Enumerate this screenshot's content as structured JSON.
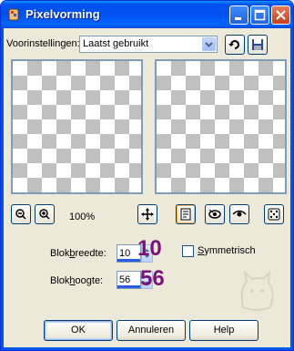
{
  "window": {
    "title": "Pixelvorming",
    "icons": {
      "app": "pixel-app-icon",
      "minimize": "minimize-icon",
      "maximize": "maximize-icon",
      "close": "close-icon"
    }
  },
  "presets": {
    "label": "Voorinstellingen:",
    "selected": "Laatst gebruikt",
    "icons": {
      "reset": "reset-icon",
      "save": "save-disk-icon"
    }
  },
  "preview_toolbar": {
    "zoom_level": "100%",
    "icons": [
      "zoom-out-icon",
      "zoom-in-icon",
      "move-icon",
      "proof-icon",
      "auto-proof-icon",
      "preview-eye-icon",
      "randomize-dice-icon"
    ]
  },
  "block_width": {
    "label_pre": "Blok",
    "label_u": "b",
    "label_post": "reedte:",
    "value": "10",
    "overlay": "10"
  },
  "block_height": {
    "label_pre": "Blok",
    "label_u": "h",
    "label_post": "oogte:",
    "value": "56",
    "overlay": "56"
  },
  "symmetric": {
    "label_u": "S",
    "label_rest": "ymmetrisch",
    "checked": false
  },
  "buttons": {
    "ok": "OK",
    "cancel": "Annuleren",
    "help": "Help"
  },
  "colors": {
    "title_bar": "#0054e3",
    "overlay_numbers": "#7b127b",
    "dialog_bg": "#ece9d8"
  }
}
